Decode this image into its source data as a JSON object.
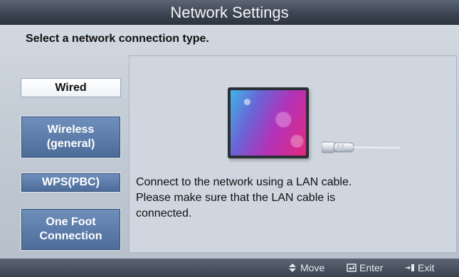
{
  "window": {
    "title": "Network Settings",
    "subtitle": "Select a network connection type."
  },
  "options": [
    {
      "label": "Wired",
      "selected": true
    },
    {
      "label": "Wireless (general)",
      "lines": [
        "Wireless",
        "(general)"
      ],
      "selected": false
    },
    {
      "label": "WPS(PBC)",
      "selected": false
    },
    {
      "label": "One Foot Connection",
      "lines": [
        "One Foot",
        "Connection"
      ],
      "selected": false
    }
  ],
  "content": {
    "description_lines": [
      "Connect to the network using a LAN cable.",
      "Please make sure that the LAN cable is",
      "connected."
    ],
    "illustration_icons": [
      "tv-icon",
      "lan-cable-icon"
    ]
  },
  "footer": {
    "hints": [
      {
        "icon": "up-down-arrows-icon",
        "label": "Move"
      },
      {
        "icon": "enter-icon",
        "label": "Enter"
      },
      {
        "icon": "exit-icon",
        "label": "Exit"
      }
    ]
  },
  "colors": {
    "title_bar": "#3c4552",
    "panel": "#c4ccd6",
    "option_button": "#4c6b98",
    "option_selected": "#ffffff"
  }
}
